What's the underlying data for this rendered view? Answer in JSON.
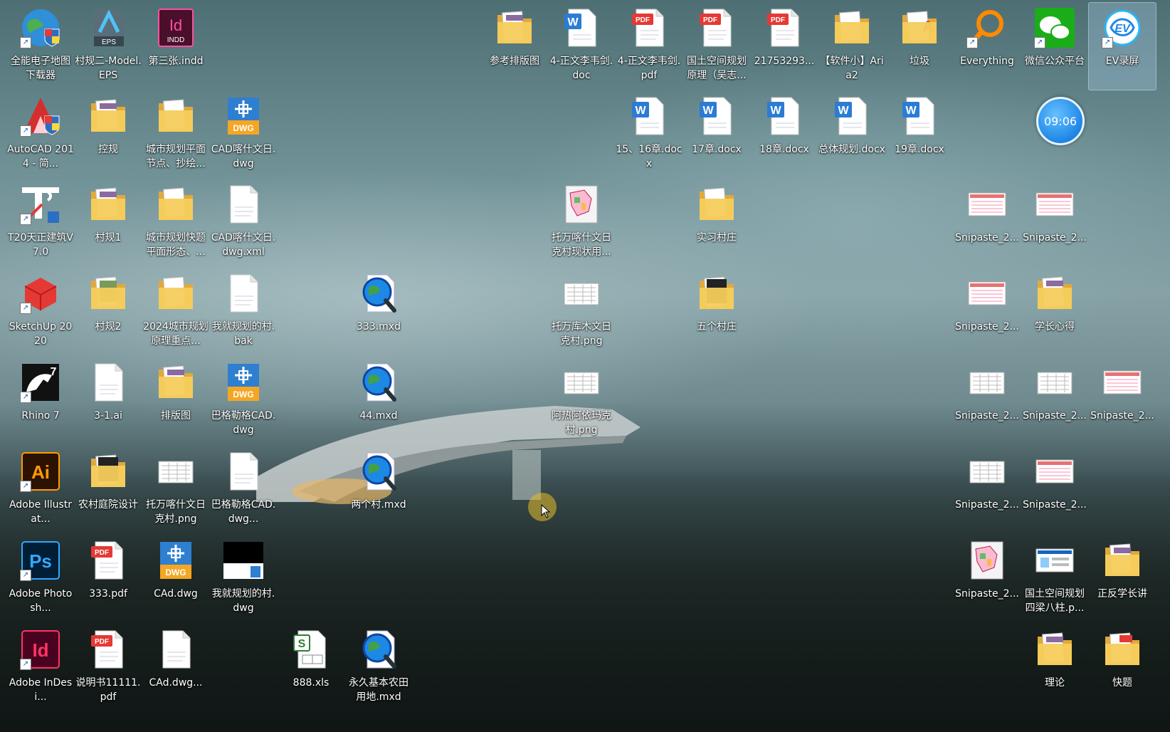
{
  "desktop": {
    "clock": "09:06",
    "icons": [
      {
        "label": "全能电子地图下载器",
        "type": "globe",
        "shortcut": true
      },
      {
        "label": "村规二-Model.EPS",
        "type": "eps"
      },
      {
        "label": "第三张.indd",
        "type": "indd"
      },
      {
        "label": "AutoCAD 2014 - 简...",
        "type": "autocad",
        "shortcut": true
      },
      {
        "label": "控规",
        "type": "folder-doc"
      },
      {
        "label": "城市规划平面节点、抄绘...",
        "type": "folder"
      },
      {
        "label": "CAD喀什文日.dwg",
        "type": "dwg"
      },
      {
        "label": "T20天正建筑V7.0",
        "type": "t20",
        "shortcut": true
      },
      {
        "label": "村规1",
        "type": "folder-doc"
      },
      {
        "label": "城市规划快题平面形态、...",
        "type": "folder"
      },
      {
        "label": "CAD喀什文日.dwg.xml",
        "type": "blank"
      },
      {
        "label": "SketchUp 2020",
        "type": "sketchup",
        "shortcut": true
      },
      {
        "label": "村规2",
        "type": "folder-green"
      },
      {
        "label": "2024城市规划原理重点...",
        "type": "folder"
      },
      {
        "label": "我就规划的村.bak",
        "type": "blank"
      },
      {
        "label": "333.mxd",
        "type": "mxd"
      },
      {
        "label": "Rhino 7",
        "type": "rhino",
        "shortcut": true
      },
      {
        "label": "3-1.ai",
        "type": "blank"
      },
      {
        "label": "排版图",
        "type": "folder-doc"
      },
      {
        "label": "巴格勒格CAD.dwg",
        "type": "dwg"
      },
      {
        "label": "44.mxd",
        "type": "mxd"
      },
      {
        "label": "Adobe Illustrat...",
        "type": "ai",
        "shortcut": true
      },
      {
        "label": "农村庭院设计",
        "type": "folder-dark"
      },
      {
        "label": "托万喀什文日克村.png",
        "type": "png"
      },
      {
        "label": "巴格勒格CAD.dwg...",
        "type": "blank"
      },
      {
        "label": "两个村.mxd",
        "type": "mxd"
      },
      {
        "label": "Adobe Photosh...",
        "type": "ps",
        "shortcut": true
      },
      {
        "label": "333.pdf",
        "type": "pdf"
      },
      {
        "label": "CAd.dwg",
        "type": "dwg"
      },
      {
        "label": "我就规划的村.dwg",
        "type": "dwg-thumb"
      },
      {
        "label": "Adobe InDesi...",
        "type": "id",
        "shortcut": true
      },
      {
        "label": "说明书11111.pdf",
        "type": "pdf"
      },
      {
        "label": "CAd.dwg...",
        "type": "blank"
      },
      {
        "label": "888.xls",
        "type": "xls"
      },
      {
        "label": "永久基本农田用地.mxd",
        "type": "mxd"
      },
      {
        "label": "参考排版图",
        "type": "folder-doc"
      },
      {
        "label": "4-正文李韦剑.doc",
        "type": "word"
      },
      {
        "label": "4-正文李韦剑.pdf",
        "type": "pdf"
      },
      {
        "label": "国土空间规划原理（吴志...",
        "type": "pdf"
      },
      {
        "label": "21753293...",
        "type": "pdf"
      },
      {
        "label": "【软件小】Aria2",
        "type": "folder"
      },
      {
        "label": "垃圾",
        "type": "folder-red"
      },
      {
        "label": "Everything",
        "type": "everything",
        "shortcut": true
      },
      {
        "label": "微信公众平台",
        "type": "wechat",
        "shortcut": true
      },
      {
        "label": "EV录屏",
        "type": "ev",
        "shortcut": true,
        "selected": true
      },
      {
        "label": "15、16章.docx",
        "type": "word"
      },
      {
        "label": "17章.docx",
        "type": "word"
      },
      {
        "label": "18章.docx",
        "type": "word"
      },
      {
        "label": "总体规划.docx",
        "type": "word"
      },
      {
        "label": "19章.docx",
        "type": "word"
      },
      {
        "label": "托万喀什文日克村现状用...",
        "type": "map"
      },
      {
        "label": "实习村庄",
        "type": "folder"
      },
      {
        "label": "托万库木文日克村.png",
        "type": "png"
      },
      {
        "label": "五个村庄",
        "type": "folder-dark"
      },
      {
        "label": "阿热阿依玛克村.png",
        "type": "png"
      },
      {
        "label": "Snipaste_2...",
        "type": "snip-red"
      },
      {
        "label": "Snipaste_2...",
        "type": "snip-red"
      },
      {
        "label": "Snipaste_2...",
        "type": "snip-red"
      },
      {
        "label": "学长心得",
        "type": "folder-doc"
      },
      {
        "label": "Snipaste_2...",
        "type": "png"
      },
      {
        "label": "Snipaste_2...",
        "type": "png"
      },
      {
        "label": "Snipaste_2...",
        "type": "snip-red"
      },
      {
        "label": "Snipaste_2...",
        "type": "png"
      },
      {
        "label": "Snipaste_2...",
        "type": "snip-red"
      },
      {
        "label": "Snipaste_2...",
        "type": "map"
      },
      {
        "label": "国土空间规划四梁八柱.p...",
        "type": "snip-blue"
      },
      {
        "label": "正反学长讲",
        "type": "folder-doc"
      },
      {
        "label": "理论",
        "type": "folder-doc"
      },
      {
        "label": "快题",
        "type": "folder-pdf"
      }
    ]
  }
}
